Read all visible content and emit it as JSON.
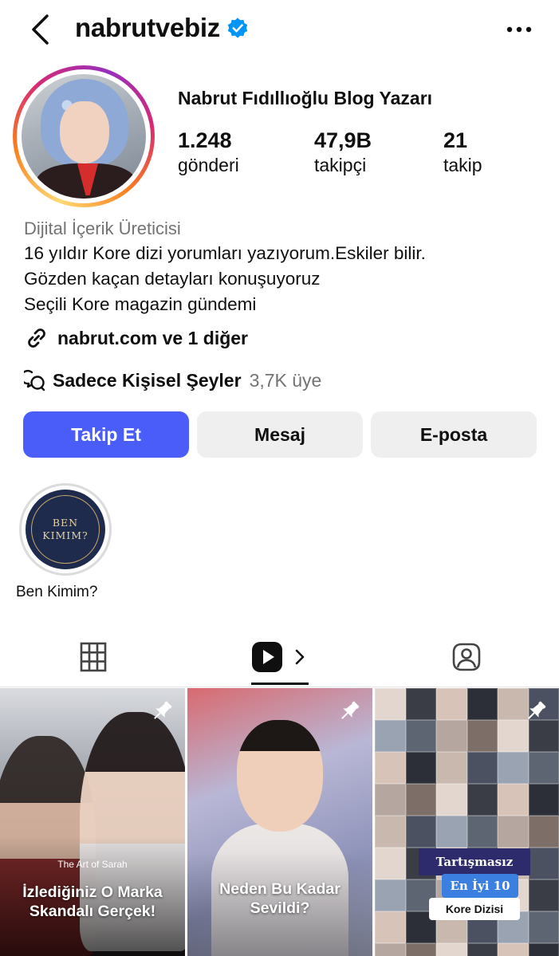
{
  "header": {
    "username": "nabrutvebiz",
    "back_icon": "chevron-left-icon",
    "verified_icon": "verified-badge-icon",
    "more_icon": "more-horizontal-icon"
  },
  "profile": {
    "display_name": "Nabrut Fıdıllıoğlu Blog Yazarı",
    "stats": {
      "posts": {
        "value": "1.248",
        "label": "gönderi"
      },
      "followers": {
        "value": "47,9B",
        "label": "takipçi"
      },
      "following": {
        "value": "21",
        "label": "takip"
      }
    },
    "category": "Dijital İçerik Üreticisi",
    "bio_lines": [
      "16 yıldır Kore dizi yorumları yazıyorum.Eskiler bilir.",
      "Gözden kaçan detayları konuşuyoruz",
      "Seçili Kore magazin gündemi"
    ],
    "link": {
      "icon": "link-icon",
      "text": "nabrut.com ve 1 diğer"
    },
    "channel": {
      "icon": "broadcast-channel-icon",
      "name": "Sadece Kişisel Şeyler",
      "members": "3,7K üye"
    }
  },
  "actions": {
    "follow": "Takip Et",
    "message": "Mesaj",
    "email": "E-posta"
  },
  "highlights": [
    {
      "cover_text_line1": "BEN",
      "cover_text_line2": "KIMIM?",
      "label": "Ben Kimim?"
    }
  ],
  "tabs": {
    "grid_icon": "grid-icon",
    "reels_icon": "reels-icon",
    "tagged_icon": "tagged-icon",
    "active": "reels"
  },
  "reels": [
    {
      "pinned": true,
      "small_text": "The Art of Sarah",
      "caption_line1": "İzlediğiniz O Marka",
      "caption_line2": "Skandalı Gerçek!"
    },
    {
      "pinned": true,
      "caption_line1": "Neden Bu Kadar",
      "caption_line2": "Sevildi?"
    },
    {
      "pinned": true,
      "badge1": "Tartışmasız",
      "badge2": "En İyi 10",
      "badge3": "Kore Dizisi"
    }
  ],
  "colors": {
    "follow_button": "#4a5df9",
    "secondary_button": "#efefef",
    "verified": "#0095f6",
    "muted_text": "#737373"
  }
}
